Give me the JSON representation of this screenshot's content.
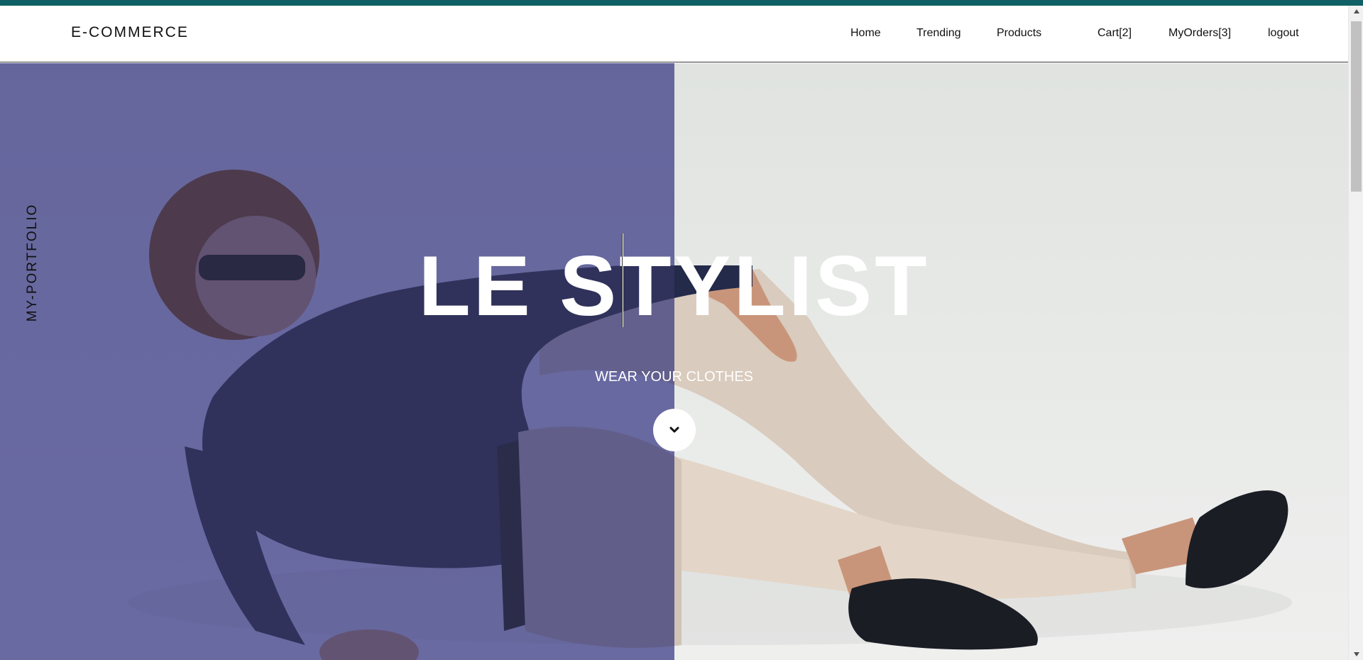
{
  "header": {
    "brand": "E-COMMERCE",
    "nav": [
      {
        "label": "Home"
      },
      {
        "label": "Trending"
      },
      {
        "label": "Products"
      },
      {
        "label": "Cart[2]"
      },
      {
        "label": "MyOrders[3]"
      },
      {
        "label": "logout"
      }
    ]
  },
  "hero": {
    "side_label": "MY-PORTFOLIO",
    "title": "LE STYLIST",
    "subtitle": "WEAR YOUR CLOTHES",
    "scroll_icon": "chevron-down-icon"
  },
  "colors": {
    "topbar": "#0f6064",
    "overlay": "#6b6ba8",
    "text_light": "#ffffff"
  }
}
